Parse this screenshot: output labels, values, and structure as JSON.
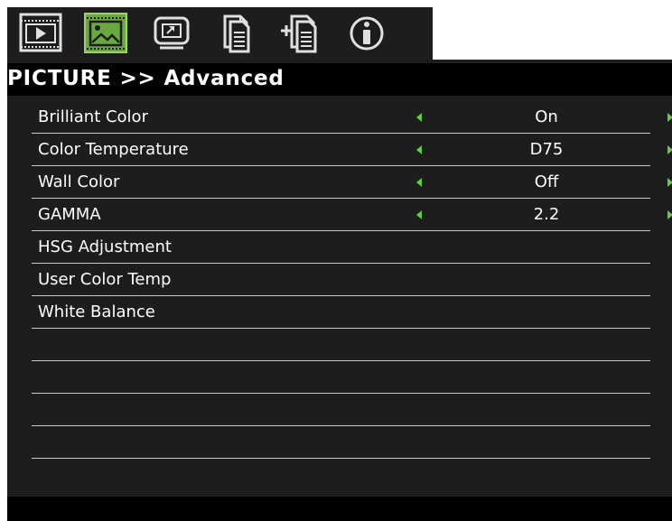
{
  "tabs": [
    {
      "name": "input-source",
      "icon": "input-icon"
    },
    {
      "name": "picture",
      "icon": "picture-icon",
      "selected": true
    },
    {
      "name": "screen",
      "icon": "screen-icon"
    },
    {
      "name": "setting",
      "icon": "document-icon"
    },
    {
      "name": "advanced-setting",
      "icon": "document-plus-icon"
    },
    {
      "name": "information",
      "icon": "info-icon"
    }
  ],
  "header": {
    "title": "PICTURE >> Advanced"
  },
  "menu": {
    "items": [
      {
        "label": "Brilliant Color",
        "value": "On"
      },
      {
        "label": "Color Temperature",
        "value": "D75"
      },
      {
        "label": "Wall Color",
        "value": "Off"
      },
      {
        "label": "GAMMA",
        "value": "2.2"
      },
      {
        "label": "HSG Adjustment"
      },
      {
        "label": "User Color Temp"
      },
      {
        "label": "White Balance"
      }
    ]
  },
  "colors": {
    "background": "#1d1d1d",
    "title_bar": "#000000",
    "selected_tab": "#6aa93e",
    "arrow": "#5cd036",
    "text": "#ffffff",
    "divider": "#c8c8c8"
  }
}
